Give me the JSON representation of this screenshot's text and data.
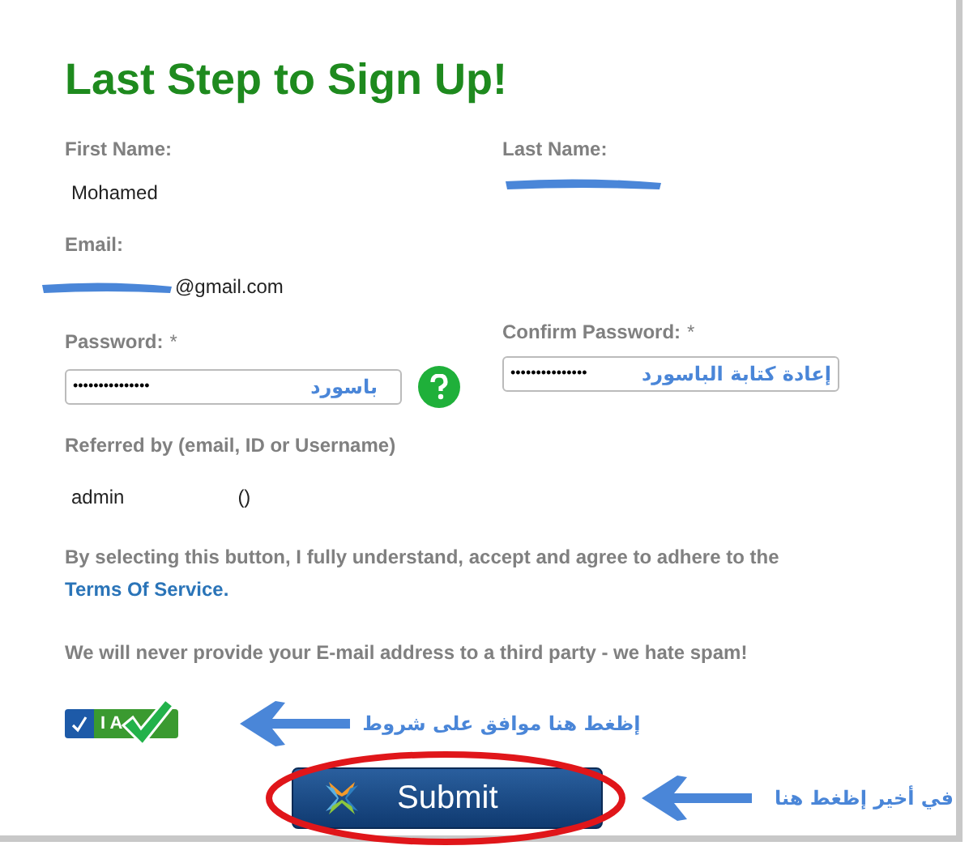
{
  "title": "Last Step to Sign Up!",
  "first_name": {
    "label": "First Name:",
    "value": "Mohamed"
  },
  "last_name": {
    "label": "Last Name:",
    "redacted": true
  },
  "email": {
    "label": "Email:",
    "redacted": true,
    "value": "@gmail.com"
  },
  "password": {
    "label": "Password:",
    "required": "*",
    "value": "•••••••••••••••",
    "note": "باسورد"
  },
  "confirm_password": {
    "label": "Confirm Password:",
    "required": "*",
    "value": "•••••••••••••••",
    "note": "إعادة كتابة الباسورد"
  },
  "referred_by": {
    "label": "Referred by (email, ID or Username)",
    "value": "admin",
    "extra": "()"
  },
  "terms": {
    "text": "By selecting this button, I fully understand, accept and agree to adhere to the",
    "link": "Terms Of Service."
  },
  "spam_note": "We will never provide your E-mail address to a third party - we hate spam!",
  "agree": {
    "label": "I A",
    "checked": true,
    "note": "إظغط هنا موافق على شروط"
  },
  "submit": {
    "label": "Submit",
    "circled": true,
    "note": "في أخير إظغط هنا"
  }
}
